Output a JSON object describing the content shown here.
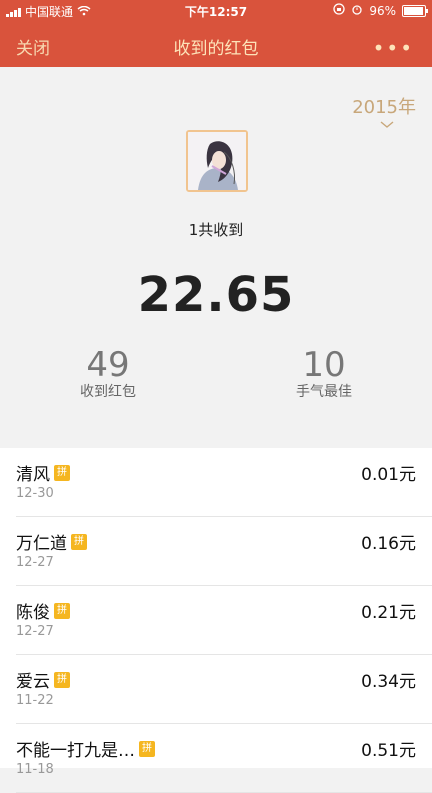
{
  "status": {
    "carrier": "中国联通",
    "time": "下午12:57",
    "battery": "96%",
    "battery_level": 0.96
  },
  "nav": {
    "close": "关闭",
    "title": "收到的红包",
    "more": "•••"
  },
  "summary": {
    "year": "2015年",
    "received_label": "1共收到",
    "total": "22.65",
    "count": "49",
    "count_label": "收到红包",
    "best": "10",
    "best_label": "手气最佳"
  },
  "list": [
    {
      "name": "清风",
      "badge": "拼",
      "date": "12-30",
      "amount": "0.01元"
    },
    {
      "name": "万仁道",
      "badge": "拼",
      "date": "12-27",
      "amount": "0.16元"
    },
    {
      "name": "陈俊",
      "badge": "拼",
      "date": "12-27",
      "amount": "0.21元"
    },
    {
      "name": "爱云",
      "badge": "拼",
      "date": "11-22",
      "amount": "0.34元"
    },
    {
      "name": "不能一打九是…",
      "badge": "拼",
      "date": "11-18",
      "amount": "0.51元"
    }
  ]
}
